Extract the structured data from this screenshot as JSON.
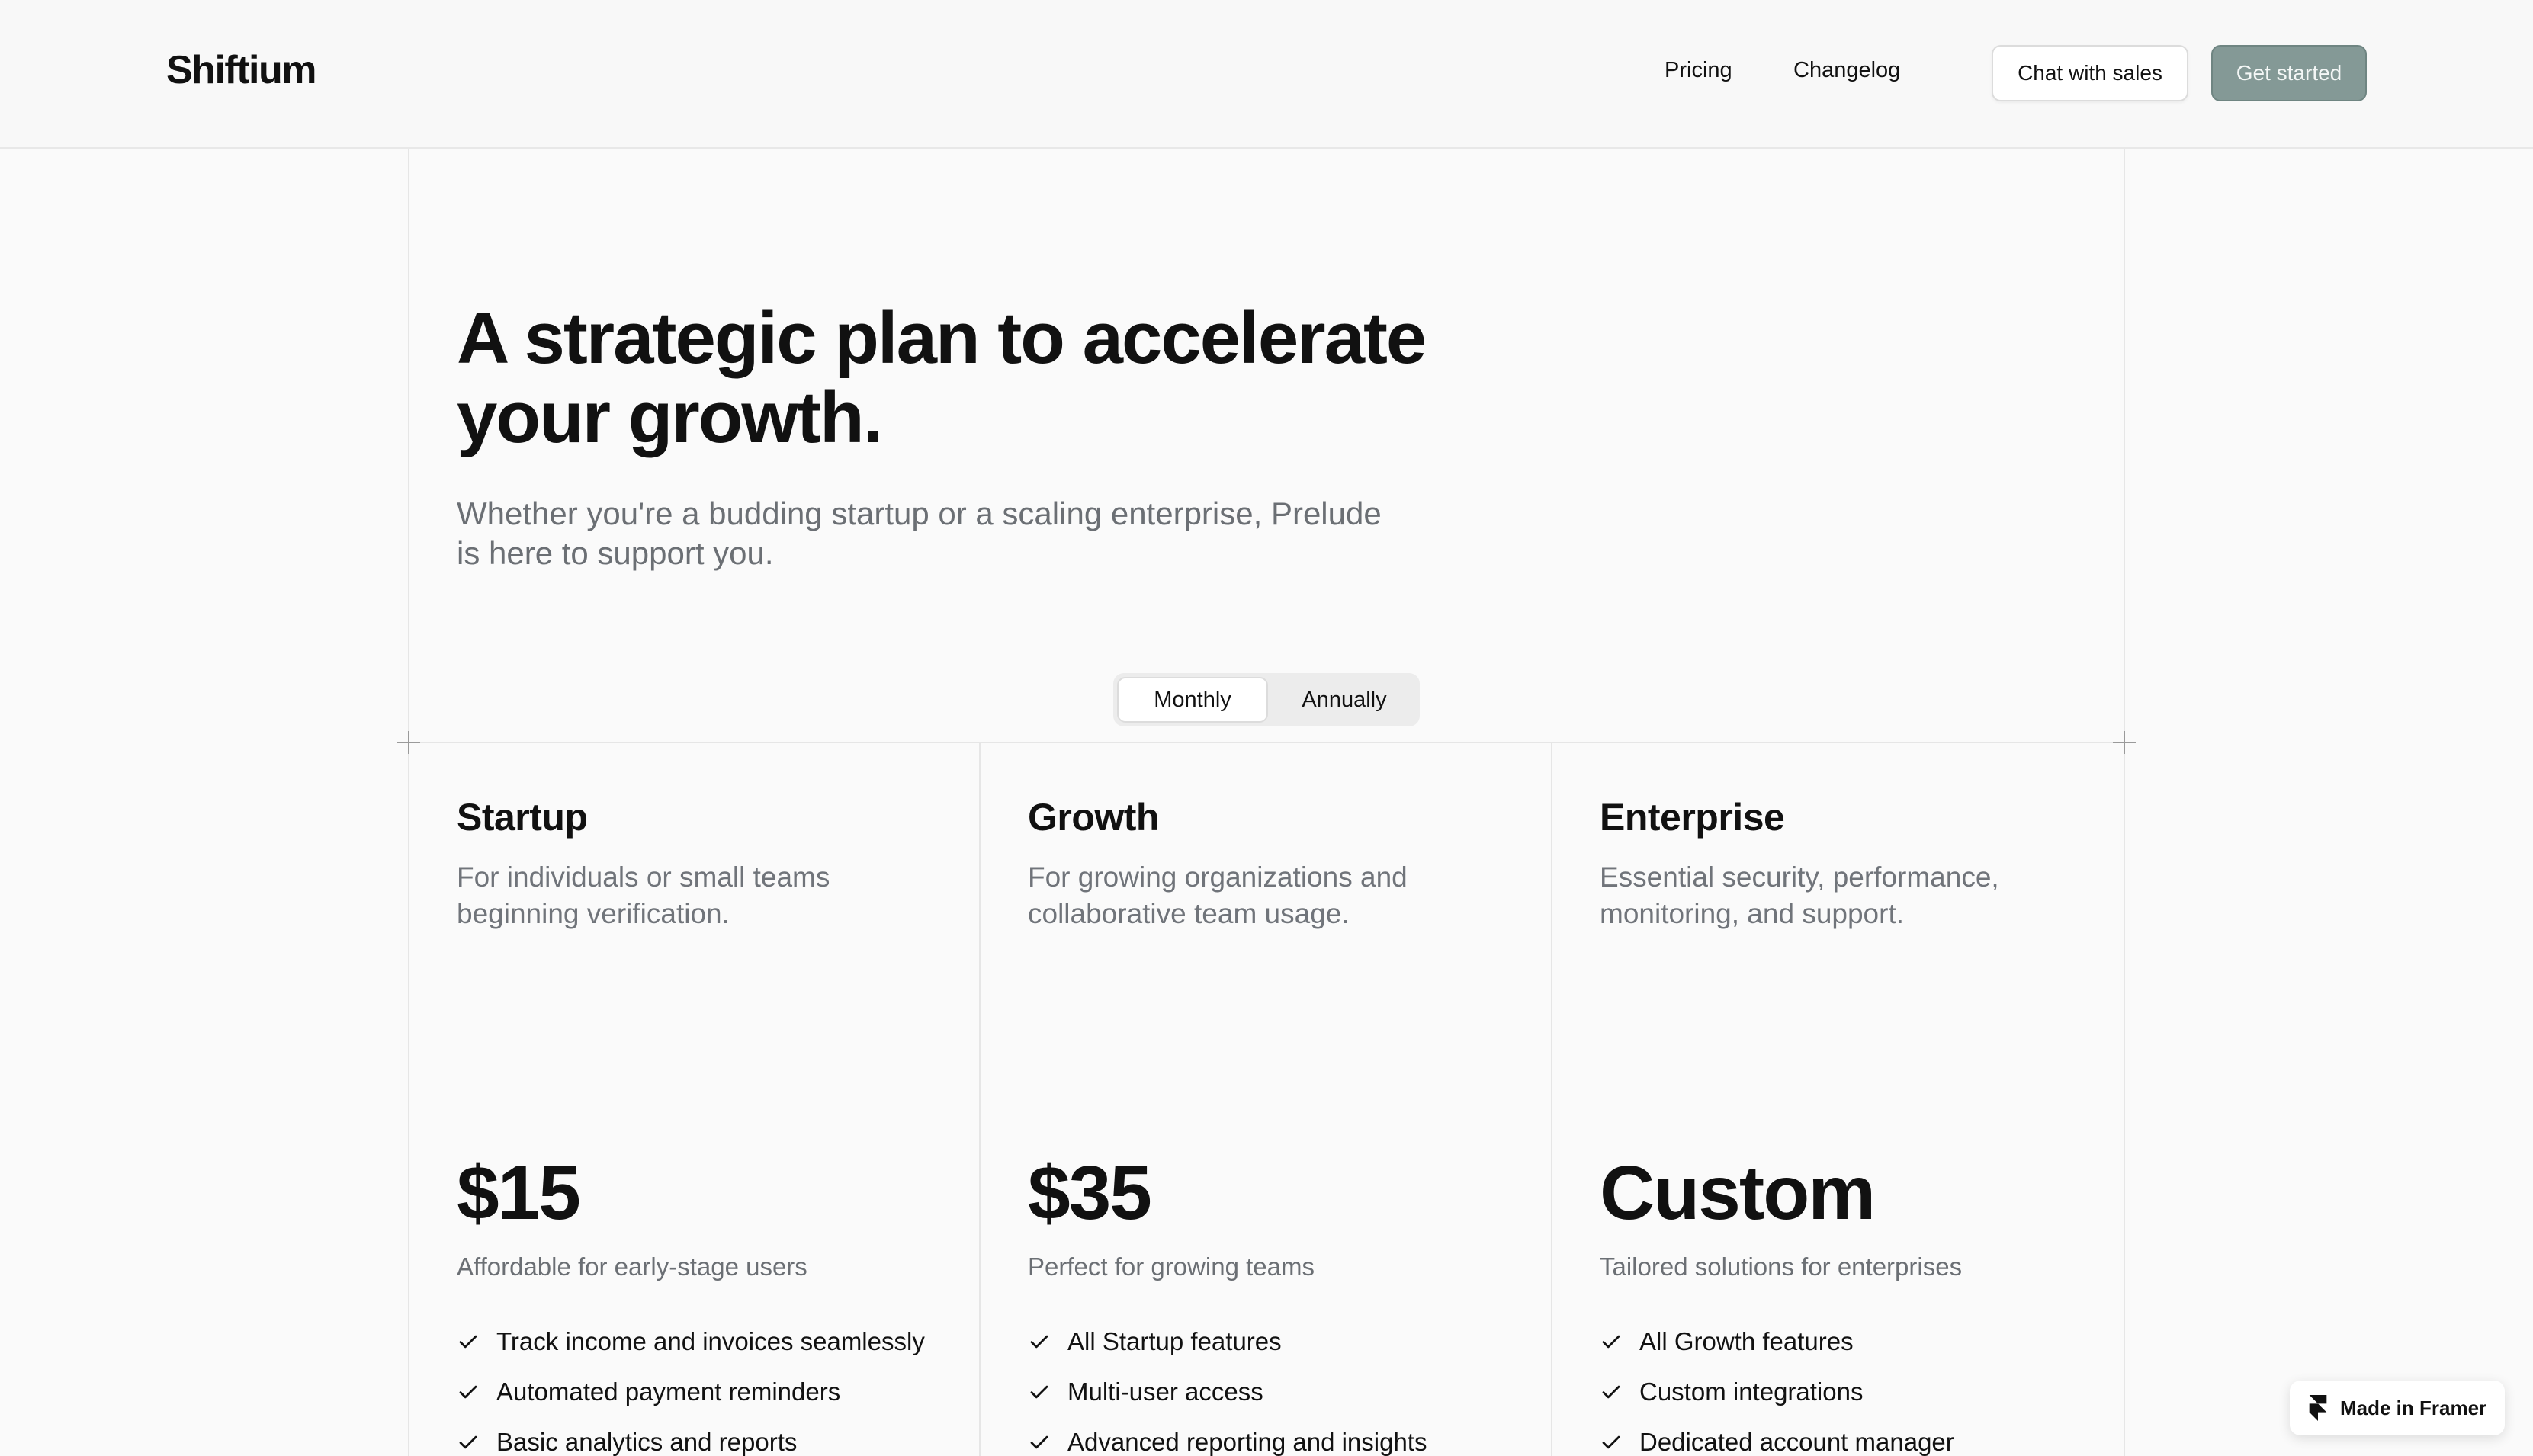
{
  "header": {
    "logo": "Shiftium",
    "nav": [
      "Pricing",
      "Changelog"
    ],
    "chat_label": "Chat with sales",
    "start_label": "Get started"
  },
  "hero": {
    "title_line1": "A strategic plan to accelerate",
    "title_line2": "your growth.",
    "subtitle_line1": "Whether you're a budding startup or a scaling enterprise, Prelude",
    "subtitle_line2": "is here to support you."
  },
  "billing_toggle": {
    "options": [
      "Monthly",
      "Annually"
    ],
    "selected": "Monthly"
  },
  "plans": [
    {
      "name": "Startup",
      "desc_line1": "For individuals or small teams",
      "desc_line2": "beginning verification.",
      "price": "$15",
      "tagline": "Affordable for early-stage users",
      "features": [
        "Track income and invoices seamlessly",
        "Automated payment reminders",
        "Basic analytics and reports"
      ]
    },
    {
      "name": "Growth",
      "desc_line1": "For growing organizations and",
      "desc_line2": "collaborative team usage.",
      "price": "$35",
      "tagline": "Perfect for growing teams",
      "features": [
        "All Startup features",
        "Multi-user access",
        "Advanced reporting and insights"
      ]
    },
    {
      "name": "Enterprise",
      "desc_line1": "Essential security, performance,",
      "desc_line2": "monitoring, and support.",
      "price": "Custom",
      "tagline": "Tailored solutions for enterprises",
      "features": [
        "All Growth features",
        "Custom integrations",
        "Dedicated account manager"
      ]
    }
  ],
  "badge": {
    "label": "Made in Framer"
  },
  "colors": {
    "accent_button": "#849996",
    "muted_text": "#6b6f74",
    "line": "#e6e6e6"
  }
}
